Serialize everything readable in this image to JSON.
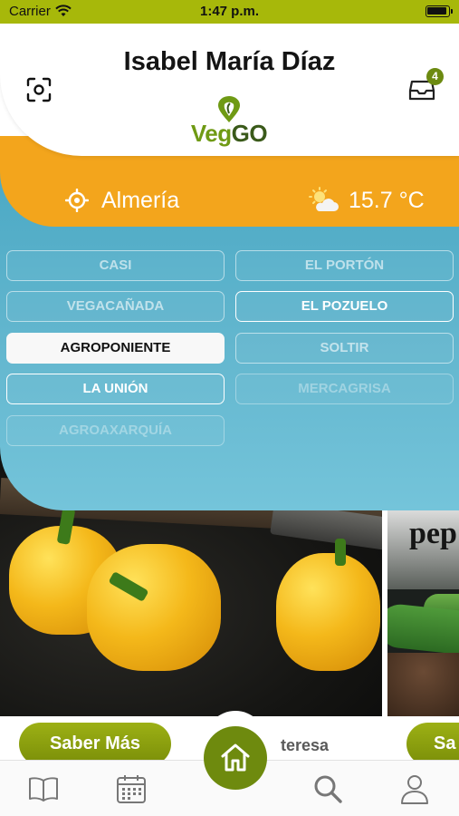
{
  "status_bar": {
    "carrier": "Carrier",
    "time": "1:47 p.m."
  },
  "header": {
    "user_name": "Isabel María Díaz",
    "inbox_badge": "4",
    "logo": {
      "veg": "Veg",
      "go": "GO"
    }
  },
  "location": {
    "city": "Almería",
    "temperature": "15.7 °C",
    "weather_icon": "partly-cloudy-icon"
  },
  "markets": [
    {
      "label": "CASI",
      "state": "dim"
    },
    {
      "label": "EL PORTÓN",
      "state": "dim"
    },
    {
      "label": "VEGACAÑADA",
      "state": "dim"
    },
    {
      "label": "EL POZUELO",
      "state": "bright"
    },
    {
      "label": "AGROPONIENTE",
      "state": "selected"
    },
    {
      "label": "SOLTIR",
      "state": "dim"
    },
    {
      "label": "LA UNIÓN",
      "state": "bright"
    },
    {
      "label": "MERCAGRISA",
      "state": "faint"
    },
    {
      "label": "AGROAXARQUÍA",
      "state": "faint"
    }
  ],
  "cards": [
    {
      "button_label": "Saber Más",
      "author": "teresa"
    },
    {
      "button_label": "Sa",
      "title_fragment": "pep"
    }
  ],
  "tabbar": {
    "tabs": [
      "book-icon",
      "calendar-icon",
      "home-icon",
      "search-icon",
      "profile-icon"
    ]
  },
  "colors": {
    "accent_green": "#6e8a0e",
    "orange": "#f3a51c",
    "blue": "#62b6ce",
    "status_bar": "#a7b80a"
  }
}
